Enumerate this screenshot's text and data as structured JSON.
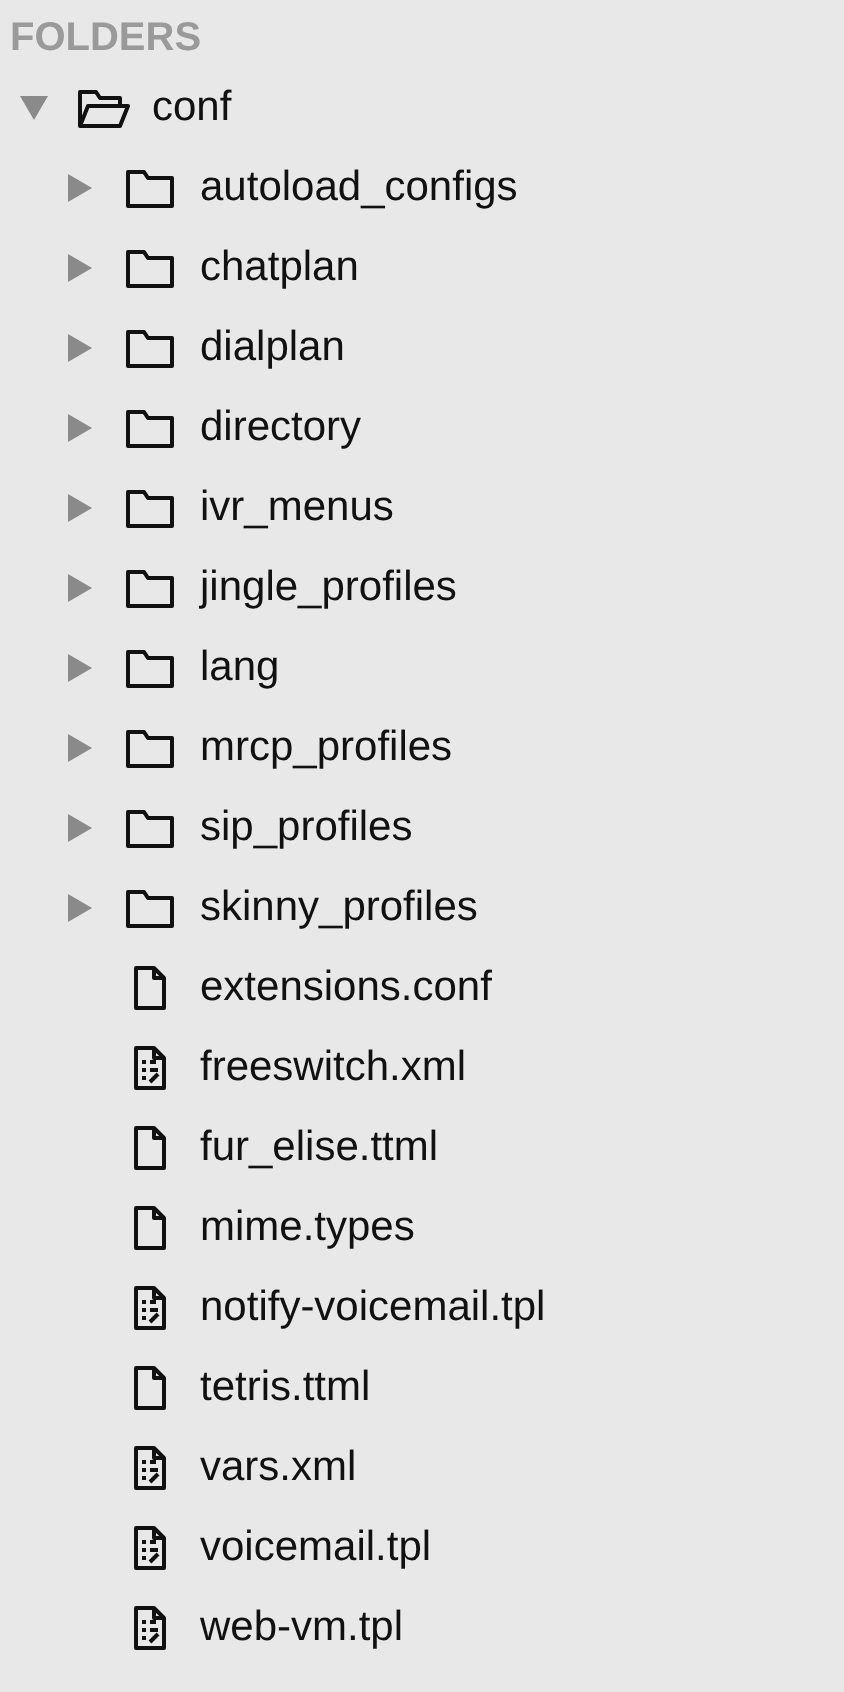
{
  "header": "FOLDERS",
  "tree": [
    {
      "name": "conf",
      "kind": "folder",
      "expanded": true,
      "children": [
        {
          "name": "autoload_configs",
          "kind": "folder",
          "expanded": false
        },
        {
          "name": "chatplan",
          "kind": "folder",
          "expanded": false
        },
        {
          "name": "dialplan",
          "kind": "folder",
          "expanded": false
        },
        {
          "name": "directory",
          "kind": "folder",
          "expanded": false
        },
        {
          "name": "ivr_menus",
          "kind": "folder",
          "expanded": false
        },
        {
          "name": "jingle_profiles",
          "kind": "folder",
          "expanded": false
        },
        {
          "name": "lang",
          "kind": "folder",
          "expanded": false
        },
        {
          "name": "mrcp_profiles",
          "kind": "folder",
          "expanded": false
        },
        {
          "name": "sip_profiles",
          "kind": "folder",
          "expanded": false
        },
        {
          "name": "skinny_profiles",
          "kind": "folder",
          "expanded": false
        },
        {
          "name": "extensions.conf",
          "kind": "file"
        },
        {
          "name": "freeswitch.xml",
          "kind": "markup_file"
        },
        {
          "name": "fur_elise.ttml",
          "kind": "file"
        },
        {
          "name": "mime.types",
          "kind": "file"
        },
        {
          "name": "notify-voicemail.tpl",
          "kind": "markup_file"
        },
        {
          "name": "tetris.ttml",
          "kind": "file"
        },
        {
          "name": "vars.xml",
          "kind": "markup_file"
        },
        {
          "name": "voicemail.tpl",
          "kind": "markup_file"
        },
        {
          "name": "web-vm.tpl",
          "kind": "markup_file"
        }
      ]
    }
  ]
}
